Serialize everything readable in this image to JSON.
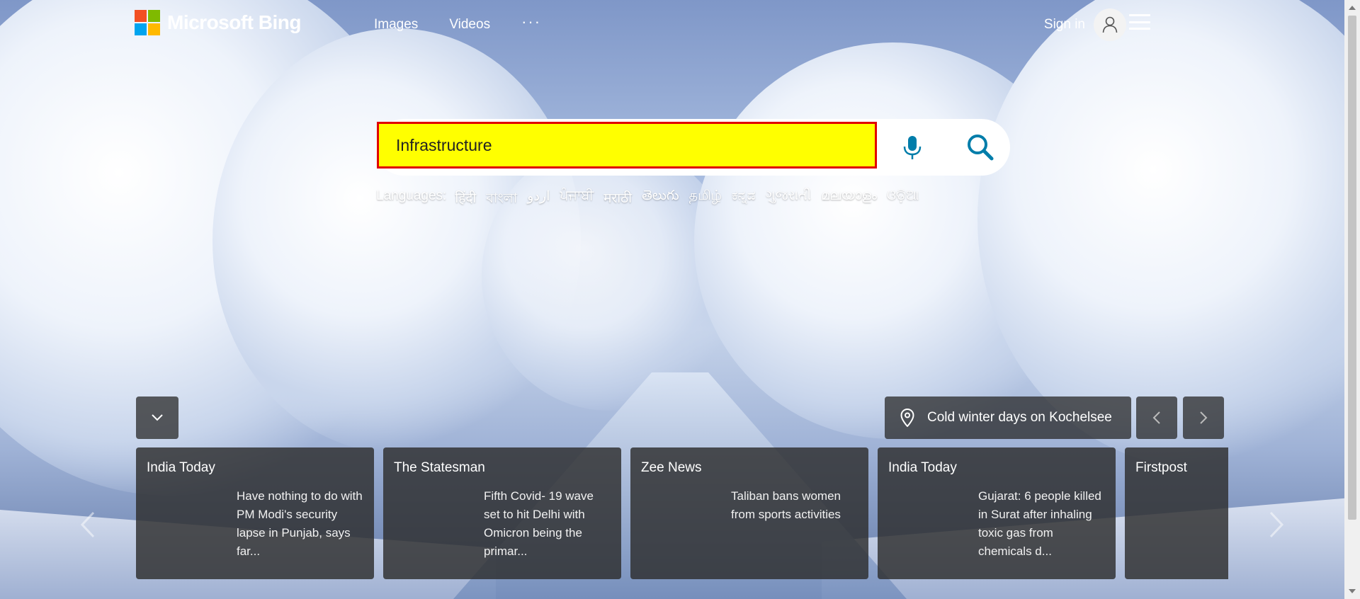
{
  "header": {
    "brand": "Microsoft Bing",
    "nav": [
      "Images",
      "Videos"
    ],
    "more": "···",
    "signin": "Sign in"
  },
  "search": {
    "value": "Infrastructure",
    "input_bg": "#ffff00",
    "input_border": "#e00000",
    "icon_color": "#007daa"
  },
  "languages": {
    "label": "Languages:",
    "items": [
      "हिंदी",
      "বাংলা",
      "اردو",
      "ਪੰਜਾਬੀ",
      "मराठी",
      "తెలుగు",
      "தமிழ்",
      "ಕನ್ನಡ",
      "ગુજરાતી",
      "മലയാളം",
      "ଓଡ଼ିଆ"
    ]
  },
  "image_caption": "Cold winter days on Kochelsee",
  "news": [
    {
      "source": "India Today",
      "headline": "Have nothing to do with PM Modi's security lapse in Punjab, says far..."
    },
    {
      "source": "The Statesman",
      "headline": "Fifth Covid- 19 wave set to hit Delhi with Omicron being the primar..."
    },
    {
      "source": "Zee News",
      "headline": "Taliban bans women from sports activities"
    },
    {
      "source": "India Today",
      "headline": "Gujarat: 6 people killed in Surat after inhaling toxic gas from chemicals d..."
    },
    {
      "source": "Firstpost",
      "headline": ""
    }
  ]
}
